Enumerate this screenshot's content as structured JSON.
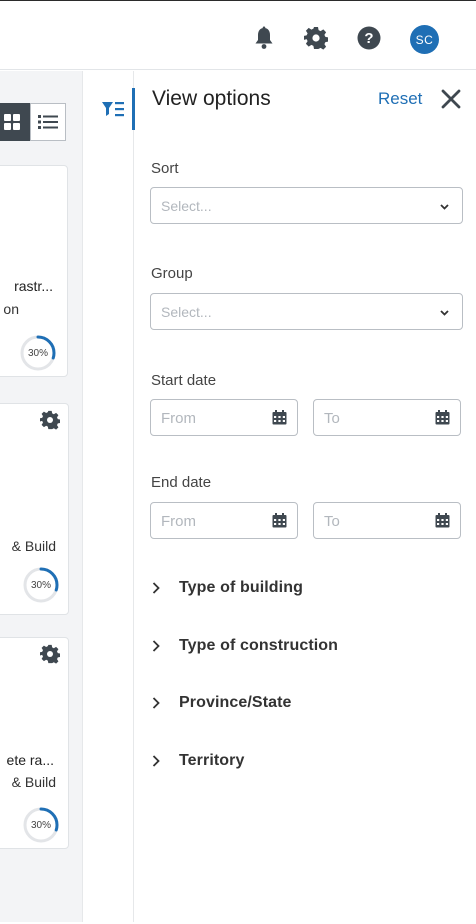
{
  "header": {
    "icons": [
      "bell-icon",
      "gear-icon",
      "help-icon"
    ],
    "avatar_initials": "SC"
  },
  "project_cards": [
    {
      "title": "rastr...",
      "subtitle": "on",
      "progress": 30,
      "progress_label": "30%"
    },
    {
      "title": "& Build",
      "subtitle": "",
      "progress": 30,
      "progress_label": "30%"
    },
    {
      "title": "ete ra...",
      "subtitle": "& Build",
      "progress": 30,
      "progress_label": "30%"
    }
  ],
  "view_options": {
    "title": "View options",
    "reset_label": "Reset",
    "sort": {
      "label": "Sort",
      "placeholder": "Select..."
    },
    "group": {
      "label": "Group",
      "placeholder": "Select..."
    },
    "start_date": {
      "label": "Start date",
      "from_placeholder": "From",
      "to_placeholder": "To"
    },
    "end_date": {
      "label": "End date",
      "from_placeholder": "From",
      "to_placeholder": "To"
    },
    "filters": [
      "Type of building",
      "Type of construction",
      "Province/State",
      "Territory"
    ]
  },
  "colors": {
    "accent": "#1f6fb5",
    "icon_dark": "#3f4850",
    "progress_track": "#e3e5e8"
  }
}
